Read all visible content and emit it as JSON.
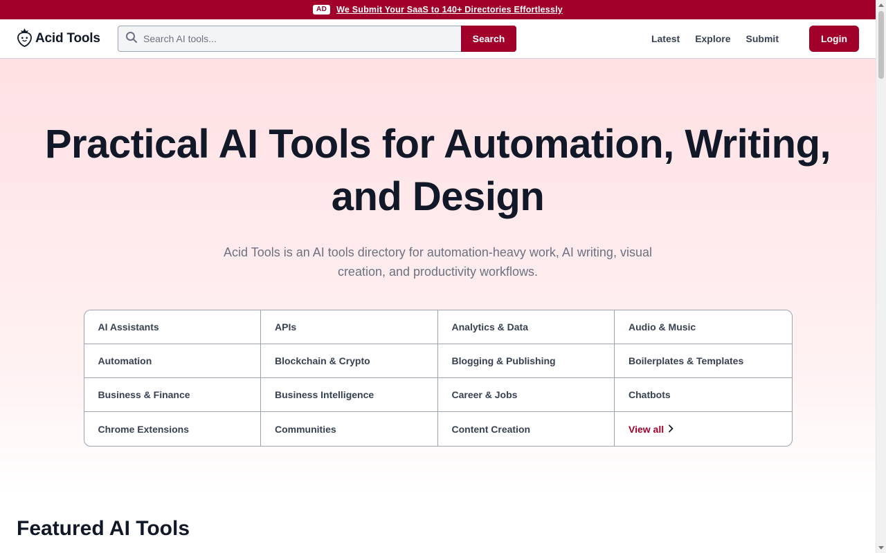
{
  "ad": {
    "badge": "AD",
    "text": "We Submit Your SaaS to 140+ Directories Effortlessly"
  },
  "header": {
    "logo_text": "Acid Tools",
    "logo_icon": "strawberry-icon",
    "search": {
      "placeholder": "Search AI tools...",
      "value": "",
      "button_label": "Search"
    },
    "nav": [
      "Latest",
      "Explore",
      "Submit"
    ],
    "login_label": "Login"
  },
  "hero": {
    "title": "Practical AI Tools for Automation, Writing, and Design",
    "subtitle": "Acid Tools is an AI tools directory for automation-heavy work, AI writing, visual creation, and productivity workflows."
  },
  "categories": [
    "AI Assistants",
    "APIs",
    "Analytics & Data",
    "Audio & Music",
    "Automation",
    "Blockchain & Crypto",
    "Blogging & Publishing",
    "Boilerplates & Templates",
    "Business & Finance",
    "Business Intelligence",
    "Career & Jobs",
    "Chatbots",
    "Chrome Extensions",
    "Communities",
    "Content Creation"
  ],
  "view_all_label": "View all",
  "featured_heading": "Featured AI Tools",
  "colors": {
    "brand": "#a1002a",
    "hero_bg_top": "#ffe0e3",
    "text_dark": "#111827",
    "text_muted": "#6b7280"
  }
}
